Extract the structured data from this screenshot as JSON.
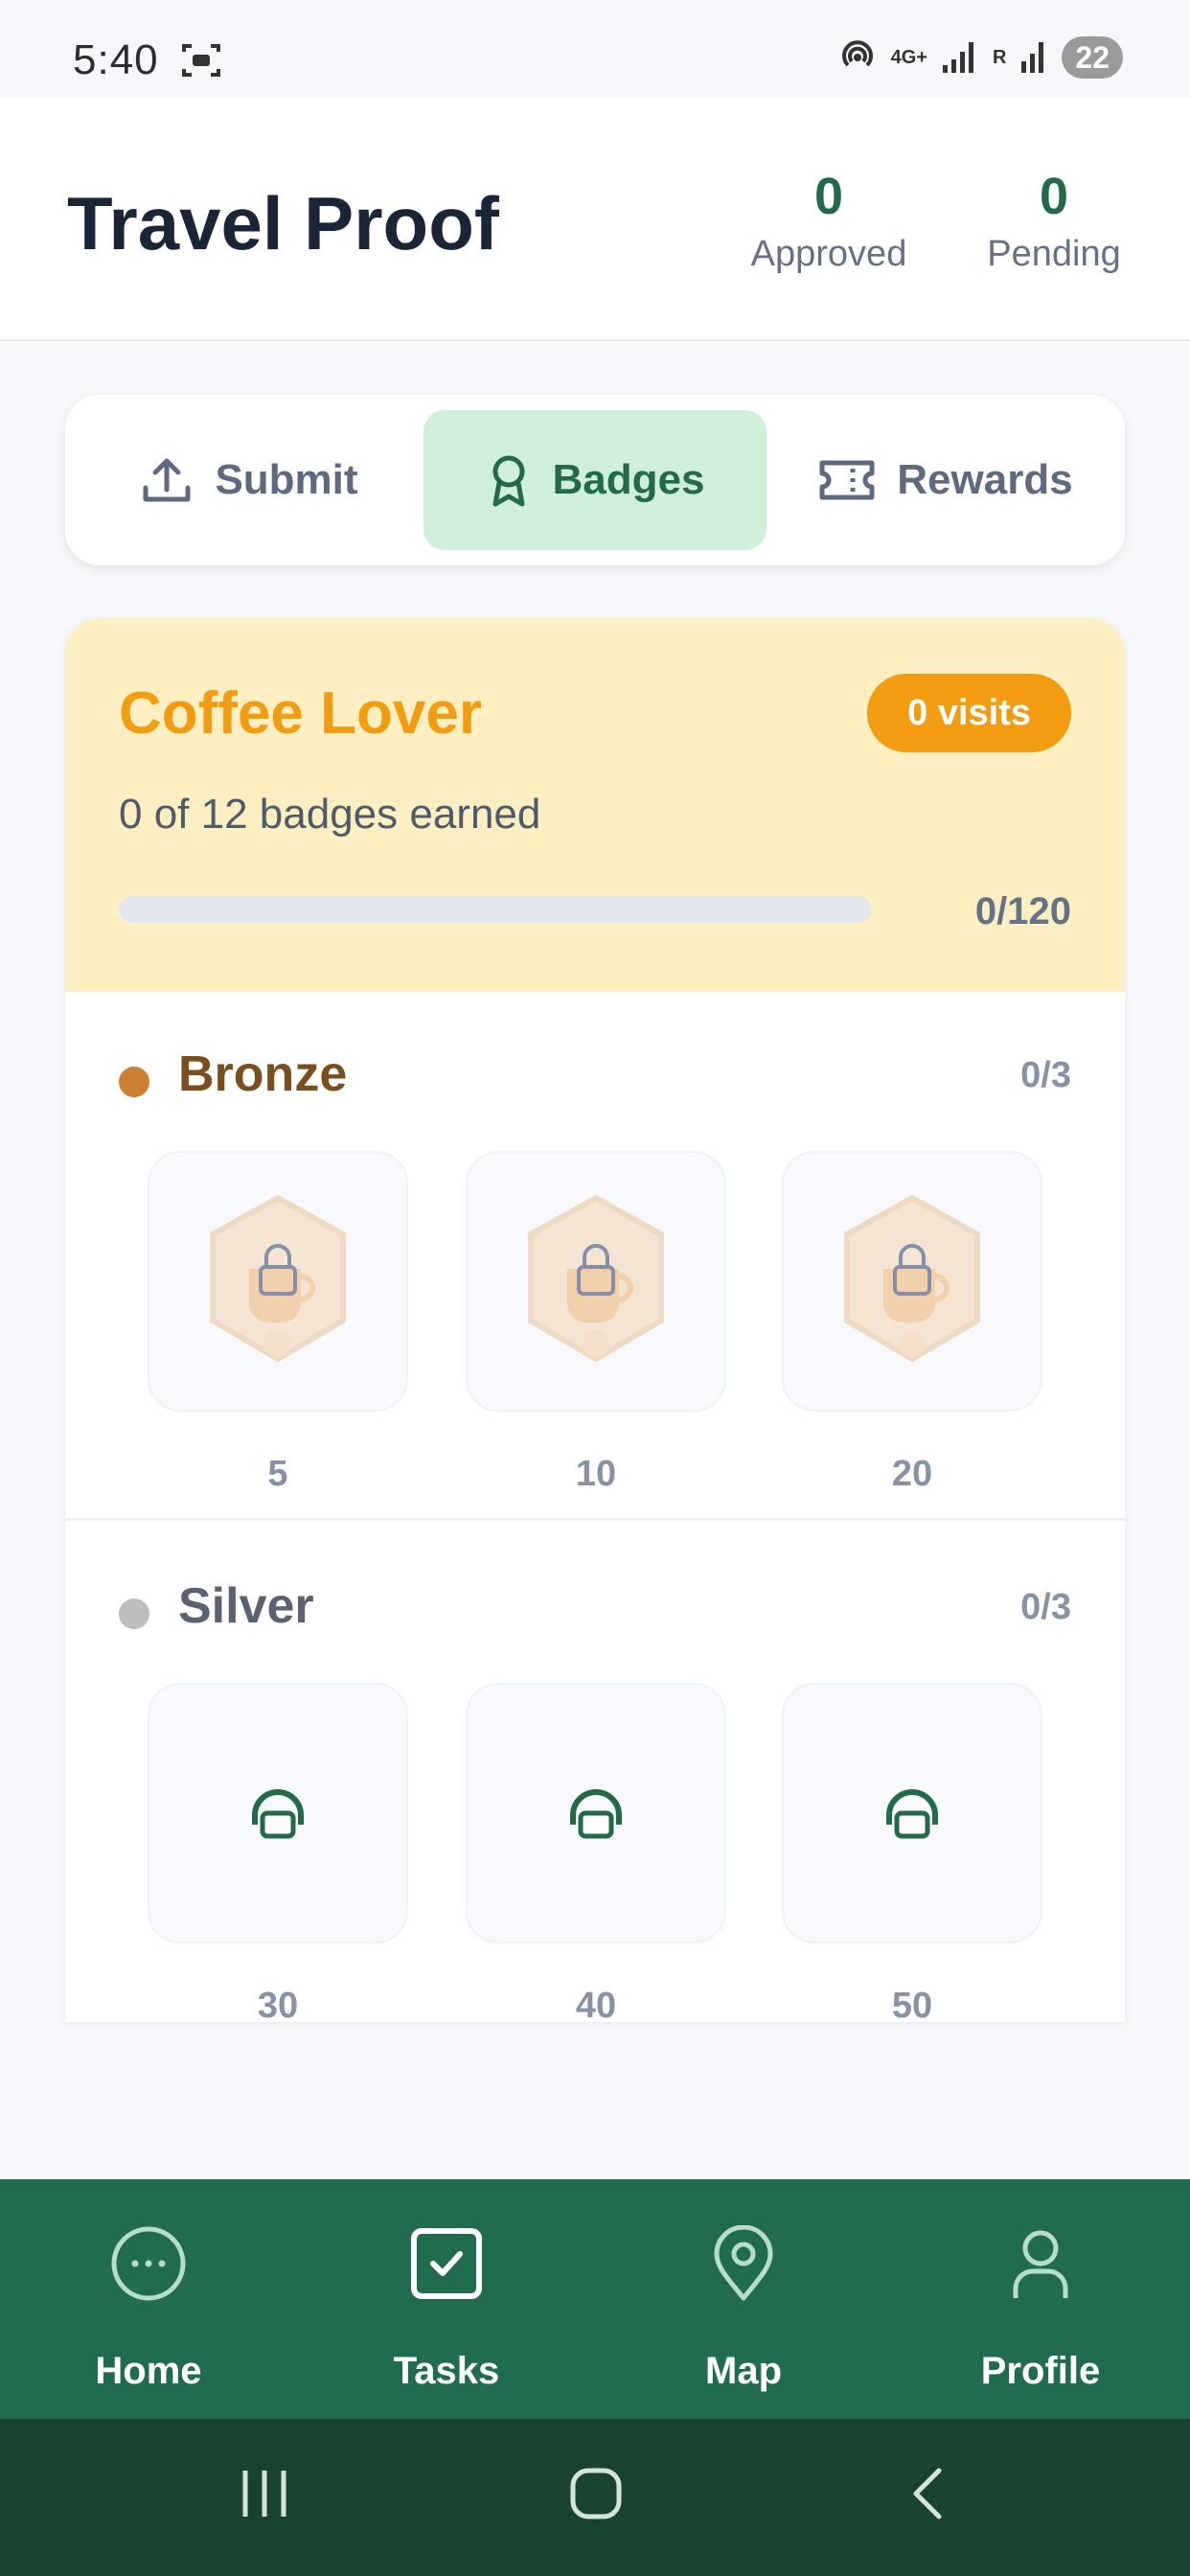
{
  "status_bar": {
    "time": "5:40",
    "network": "4G+",
    "carrier": "R",
    "battery": "22"
  },
  "header": {
    "title": "Travel Proof",
    "stats": [
      {
        "value": "0",
        "label": "Approved"
      },
      {
        "value": "0",
        "label": "Pending"
      }
    ]
  },
  "tabs": [
    {
      "label": "Submit",
      "icon": "upload-icon",
      "active": false
    },
    {
      "label": "Badges",
      "icon": "award-icon",
      "active": true
    },
    {
      "label": "Rewards",
      "icon": "ticket-icon",
      "active": false
    }
  ],
  "badge_card": {
    "title": "Coffee Lover",
    "visits": "0 visits",
    "earned_text": "0 of 12 badges earned",
    "progress_text": "0/120",
    "progress_fraction": 0,
    "tiers": [
      {
        "name": "Bronze",
        "count": "0/3",
        "color": "#cd7f32",
        "text_color": "#7a4e1e",
        "thresholds": [
          "5",
          "10",
          "20"
        ]
      },
      {
        "name": "Silver",
        "count": "0/3",
        "color": "#bdbdbd",
        "text_color": "#5b6170",
        "thresholds": [
          "30",
          "40",
          "50"
        ]
      }
    ]
  },
  "bottom_nav": [
    {
      "label": "Home",
      "icon": "home-dots-icon"
    },
    {
      "label": "Tasks",
      "icon": "checkbox-icon"
    },
    {
      "label": "Map",
      "icon": "map-pin-icon"
    },
    {
      "label": "Profile",
      "icon": "user-icon"
    }
  ],
  "colors": {
    "brand_green": "#216c4f",
    "accent_orange": "#f39c12",
    "active_tab_bg": "#cfefda"
  }
}
